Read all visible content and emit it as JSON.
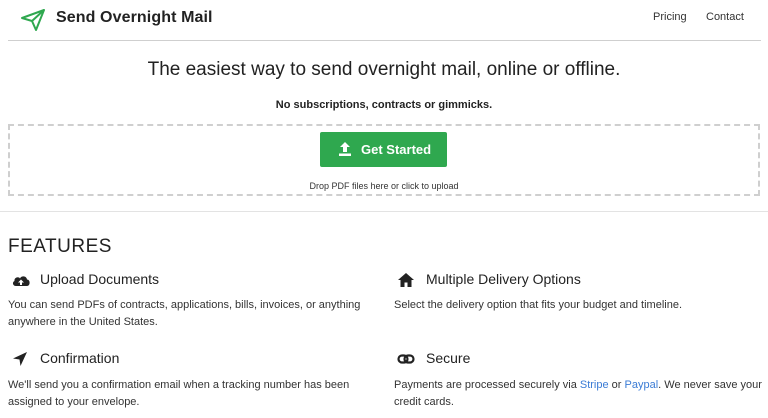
{
  "header": {
    "brand": "Send Overnight Mail",
    "nav": [
      {
        "label": "Pricing"
      },
      {
        "label": "Contact"
      }
    ]
  },
  "hero": {
    "title": "The easiest way to send overnight mail, online or offline.",
    "subtitle": "No subscriptions, contracts or gimmicks.",
    "cta_label": "Get Started",
    "drop_hint": "Drop PDF files here or click to upload"
  },
  "features": {
    "heading": "FEATURES",
    "items": [
      {
        "icon": "cloud-upload-icon",
        "title": "Upload Documents",
        "description": "You can send PDFs of contracts, applications, bills, invoices, or anything anywhere in the United States."
      },
      {
        "icon": "home-icon",
        "title": "Multiple Delivery Options",
        "description": "Select the delivery option that fits your budget and timeline."
      },
      {
        "icon": "location-arrow-icon",
        "title": "Confirmation",
        "description": "We'll send you a confirmation email when a tracking number has been assigned to your envelope."
      },
      {
        "icon": "link-icon",
        "title": "Secure",
        "description_prefix": "Payments are processed securely via ",
        "link_stripe": "Stripe",
        "description_mid": " or ",
        "link_paypal": "Paypal",
        "description_suffix": ". We never save your credit cards."
      }
    ]
  },
  "colors": {
    "accent": "#2fa84f",
    "brand_icon": "#2fa84f",
    "link": "#3a7bd5",
    "rule": "#cfcfcf"
  }
}
